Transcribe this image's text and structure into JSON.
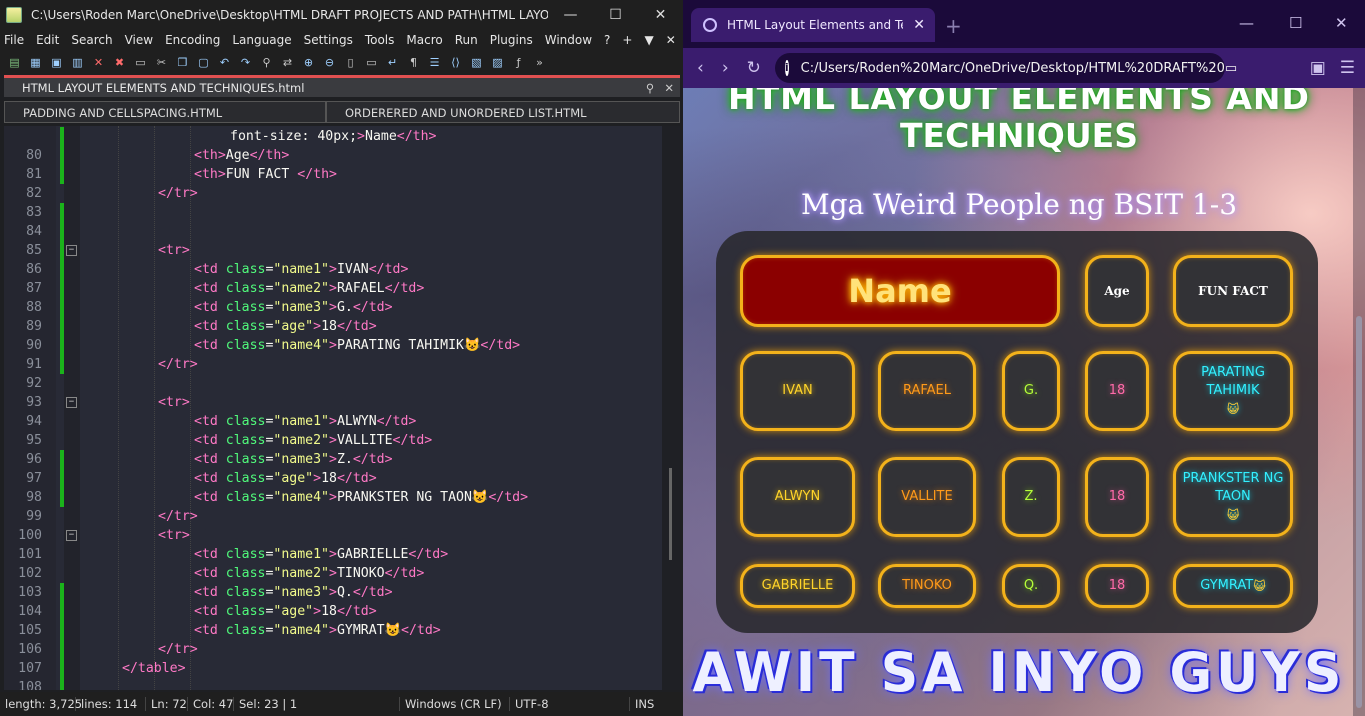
{
  "npp": {
    "title": "C:\\Users\\Roden Marc\\OneDrive\\Desktop\\HTML DRAFT PROJECTS AND PATH\\HTML LAYOUT EL...",
    "menu": [
      "File",
      "Edit",
      "Search",
      "View",
      "Encoding",
      "Language",
      "Settings",
      "Tools",
      "Macro",
      "Run",
      "Plugins",
      "Window",
      "?",
      "+",
      "▼",
      "✕"
    ],
    "active_tab": "HTML LAYOUT ELEMENTS  AND TECHNIQUES.html",
    "tab2": "PADDING AND CELLSPACING.HTML",
    "tab3": "ORDERERED AND UNORDERED LIST.HTML",
    "status": {
      "length": "length: 3,725",
      "lines": "lines: 114",
      "ln": "Ln: 72",
      "col": "Col: 47",
      "sel": "Sel: 23 | 1",
      "eol": "Windows (CR LF)",
      "enc": "UTF-8",
      "ins": "INS"
    },
    "lines": [
      {
        "n": "",
        "code": "font-size: 40px;\">Name</th>"
      },
      {
        "n": "80",
        "code": "<th>Age</th>"
      },
      {
        "n": "81",
        "code": "<th>FUN FACT </th>"
      },
      {
        "n": "82",
        "code": "</tr>"
      },
      {
        "n": "83",
        "code": ""
      },
      {
        "n": "84",
        "code": ""
      },
      {
        "n": "85",
        "code": "<tr>"
      },
      {
        "n": "86",
        "code": "<td class=\"name1\">IVAN</td>"
      },
      {
        "n": "87",
        "code": "<td class=\"name2\">RAFAEL</td>"
      },
      {
        "n": "88",
        "code": "<td class=\"name3\">G.</td>"
      },
      {
        "n": "89",
        "code": "<td class=\"age\">18</td>"
      },
      {
        "n": "90",
        "code": "<td class=\"name4\">PARATING TAHIMIK😺</td>"
      },
      {
        "n": "91",
        "code": "</tr>"
      },
      {
        "n": "92",
        "code": ""
      },
      {
        "n": "93",
        "code": "<tr>"
      },
      {
        "n": "94",
        "code": "<td class=\"name1\">ALWYN</td>"
      },
      {
        "n": "95",
        "code": "<td class=\"name2\">VALLITE</td>"
      },
      {
        "n": "96",
        "code": "<td class=\"name3\">Z.</td>"
      },
      {
        "n": "97",
        "code": "<td class=\"age\">18</td>"
      },
      {
        "n": "98",
        "code": "<td class=\"name4\">PRANKSTER NG TAON😺</td>"
      },
      {
        "n": "99",
        "code": "</tr>"
      },
      {
        "n": "100",
        "code": "<tr>"
      },
      {
        "n": "101",
        "code": "<td class=\"name1\">GABRIELLE</td>"
      },
      {
        "n": "102",
        "code": "<td class=\"name2\">TINOKO</td>"
      },
      {
        "n": "103",
        "code": "<td class=\"name3\">Q.</td>"
      },
      {
        "n": "104",
        "code": "<td class=\"age\">18</td>"
      },
      {
        "n": "105",
        "code": "<td class=\"name4\">GYMRAT😺</td>"
      },
      {
        "n": "106",
        "code": "</tr>"
      },
      {
        "n": "107",
        "code": "</table>"
      },
      {
        "n": "108",
        "code": ""
      }
    ]
  },
  "browser": {
    "tab_title": "HTML Layout Elements and Techn",
    "url": "C:/Users/Roden%20Marc/OneDrive/Desktop/HTML%20DRAFT%20",
    "page": {
      "h1_line1": "HTML LAYOUT ELEMENTS AND",
      "h1_line2": "TECHNIQUES",
      "h2": "Mga Weird People ng BSIT 1-3",
      "headers": {
        "name": "Name",
        "age": "Age",
        "fun": "FUN FACT"
      },
      "rows": [
        {
          "name1": "IVAN",
          "name2": "RAFAEL",
          "name3": "G.",
          "age": "18",
          "name4": "PARATING TAHIMIK"
        },
        {
          "name1": "ALWYN",
          "name2": "VALLITE",
          "name3": "Z.",
          "age": "18",
          "name4": "PRANKSTER NG TAON"
        },
        {
          "name1": "GABRIELLE",
          "name2": "TINOKO",
          "name3": "Q.",
          "age": "18",
          "name4": "GYMRAT"
        }
      ],
      "emoji": "😺",
      "footer": "AWIT SA INYO GUYS"
    }
  },
  "colors": {
    "accent_glow": "#f3b21b",
    "name_header_bg": "#8b0000",
    "browser_chrome": "#3a1c6e"
  }
}
